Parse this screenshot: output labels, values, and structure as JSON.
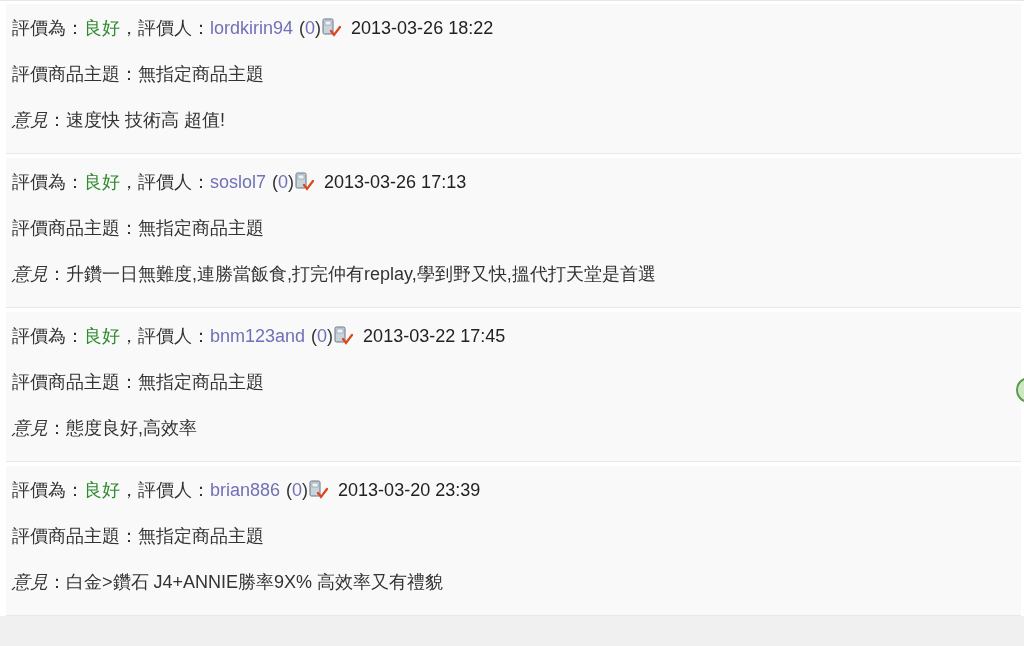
{
  "reviews": [
    {
      "rating_label": "評價為：",
      "rating": "良好",
      "rater_label": "，評價人：",
      "rater": "lordkirin94",
      "score_open": "(",
      "score": "0",
      "score_close": ")",
      "date": "2013-03-26 18:22",
      "subject": "評價商品主題：無指定商品主題",
      "comment": "*意見*：速度快 技術高 超值!"
    },
    {
      "rating_label": "評價為：",
      "rating": "良好",
      "rater_label": "，評價人：",
      "rater": "soslol7",
      "score_open": "(",
      "score": "0",
      "score_close": ")",
      "date": "2013-03-26 17:13",
      "subject": "評價商品主題：無指定商品主題",
      "comment": "*意見*：升鑽一日無難度,連勝當飯食,打完仲有replay,學到野又快,搵代打天堂是首選"
    },
    {
      "rating_label": "評價為：",
      "rating": "良好",
      "rater_label": "，評價人：",
      "rater": "bnm123and",
      "score_open": "(",
      "score": "0",
      "score_close": ")",
      "date": "2013-03-22 17:45",
      "subject": "評價商品主題：無指定商品主題",
      "comment": "*意見*：態度良好,高效率"
    },
    {
      "rating_label": "評價為：",
      "rating": "良好",
      "rater_label": "，評價人：",
      "rater": "brian886",
      "score_open": "(",
      "score": "0",
      "score_close": ")",
      "date": "2013-03-20 23:39",
      "subject": "評價商品主題：無指定商品主題",
      "comment": "*意見*：白金>鑽石 J4+ANNIE勝率9X% 高效率又有禮貌"
    }
  ]
}
